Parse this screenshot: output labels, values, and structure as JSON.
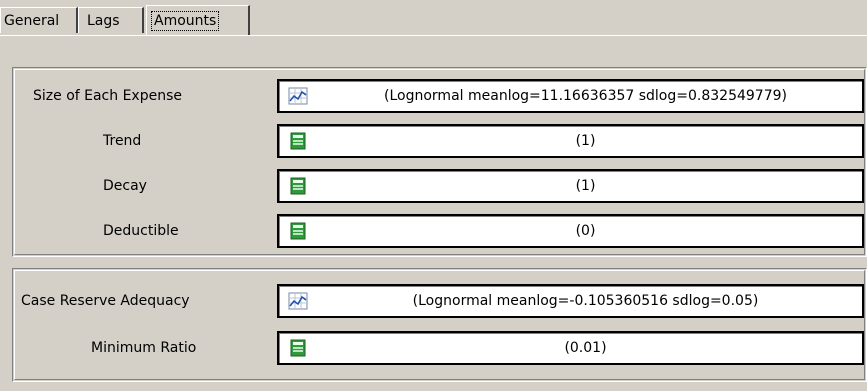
{
  "tabs": [
    {
      "label": "General"
    },
    {
      "label": "Lags"
    },
    {
      "label": "Amounts"
    }
  ],
  "expense_group": {
    "rows": [
      {
        "label": "Size of Each Expense",
        "icon": "distribution-chart-icon",
        "value": "(Lognormal meanlog=11.16636357  sdlog=0.832549779)"
      },
      {
        "label": "Trend",
        "icon": "spreadsheet-icon",
        "value": "(1)"
      },
      {
        "label": "Decay",
        "icon": "spreadsheet-icon",
        "value": "(1)"
      },
      {
        "label": "Deductible",
        "icon": "spreadsheet-icon",
        "value": "(0)"
      }
    ]
  },
  "reserve_group": {
    "rows": [
      {
        "label": "Case Reserve Adequacy",
        "icon": "distribution-chart-icon",
        "value": "(Lognormal meanlog=-0.105360516  sdlog=0.05)"
      },
      {
        "label": "Minimum Ratio",
        "icon": "spreadsheet-icon",
        "value": "(0.01)"
      }
    ]
  }
}
